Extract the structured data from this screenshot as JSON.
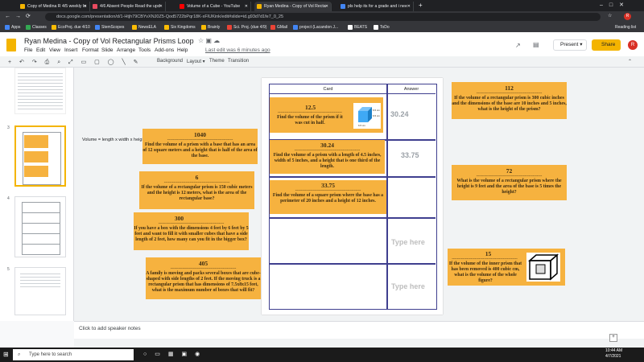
{
  "browser": {
    "tabs": [
      {
        "label": "Copy of Medina R 4/5 weekly lo",
        "color": "#f4b400"
      },
      {
        "label": "4/6 Absent People Read the upd",
        "color": "#e84a5f"
      },
      {
        "label": "Volume of a Cube - YouTube",
        "color": "#ff0000"
      },
      {
        "label": "Ryan Medina - Copy of Vol Recta",
        "color": "#f4b400"
      },
      {
        "label": "pls help its for a grade and i nee",
        "color": "#4285f4"
      }
    ],
    "url": "docs.google.com/presentation/d/1-Htjh79CBYvXNJ0Z5-Qod5722bPqr18K-xFIUKink/edit#slide=id.g93d7d1fe7_0_25",
    "bookmarks": [
      "Apps",
      "Classes",
      "EcoProj. due 4/10",
      "StemScopes",
      "NewsELA",
      "Six Kingdoms",
      "Brainly",
      "Sci. Proj. (due 4/9)",
      "GMail",
      "project (Lacandon J...",
      "BEATS",
      "ToDo"
    ],
    "reading_list": "Reading list"
  },
  "doc": {
    "title": "Ryan Medina - Copy of Vol Rectangular Prisms Loop",
    "menus": [
      "File",
      "Edit",
      "View",
      "Insert",
      "Format",
      "Slide",
      "Arrange",
      "Tools",
      "Add-ons",
      "Help"
    ],
    "last_edit": "Last edit was 6 minutes ago",
    "present": "Present",
    "share": "Share",
    "avatar": "R"
  },
  "toolbar": {
    "background": "Background",
    "layout": "Layout",
    "theme": "Theme",
    "transition": "Transition"
  },
  "filmstrip": {
    "nums": [
      "3",
      "4",
      "5"
    ]
  },
  "slide": {
    "formula": "Volume = length x width x height",
    "col_card": "Card",
    "col_answer": "Answer",
    "type_here": "Type here",
    "dashes": "-------------------------------------------------",
    "rows": [
      {
        "num": "12.5",
        "q": "Find the volume of the prism if it was cut in half.",
        "answer": "30.24"
      },
      {
        "num": "30.24",
        "q": "Find the volume of a prism with a length of 4.5 inches, width of 5 inches, and a height that is one third of the length.",
        "answer": "33.75"
      },
      {
        "num": "33.75",
        "q": "Find the volume of a square prism where the base has a perimeter of 20 inches and a height of 12 inches.",
        "answer": ""
      }
    ],
    "cube_labels": [
      "6.5 cm",
      "6.5 cm",
      "6.5 cm"
    ]
  },
  "left_cards": [
    {
      "num": "1040",
      "q": "Find the volume of a prism with a base that has an area of 12 square meters and a height that is half of the area of the base."
    },
    {
      "num": "6",
      "q": "If the volume of a rectangular prism is 150 cubic meters and the height is 12 meters, what is the area of the rectangular base?"
    },
    {
      "num": "300",
      "q": "If you have a box with the dimensions 4 feet by 6 feet by 5 feet and want to fill it with smaller cubes that have a side length of 2 feet, how many can you fit in the bigger box?"
    },
    {
      "num": "405",
      "q": "A family is moving and packs several boxes that are cube-shaped with side lengths of 2 feet. If the moving truck is a rectangular prism that has dimensions of 7.5x8x15 feet, what is the maximum number of boxes that will fit?"
    }
  ],
  "right_cards": [
    {
      "num": "112",
      "q": "If the volume of a rectangular prism is 300 cubic inches and the dimensions of the base are 10 inches and 5 inches, what is the height of the prism?"
    },
    {
      "num": "72",
      "q": "What is the volume of a rectangular prism where the height is 9 feet and the area of the base is 5 times the height?"
    },
    {
      "num": "15",
      "q": "If the volume of the inner prism that has been removed is 400 cubic cm, what is the volume of the whole figure?"
    }
  ],
  "notes": "Click to add speaker notes",
  "taskbar": {
    "search": "Type here to search",
    "time": "10:44 AM",
    "date": "4/7/2021"
  }
}
